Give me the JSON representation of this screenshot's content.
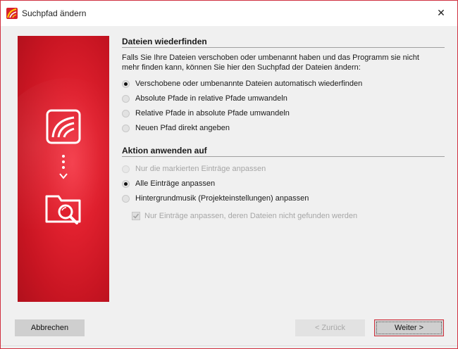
{
  "window": {
    "title": "Suchpfad ändern",
    "close_glyph": "✕",
    "app_icon": "app-logo-icon"
  },
  "colors": {
    "accent": "#d0303c",
    "panel_red": "#e0202e",
    "background": "#f0f0f0"
  },
  "panel": {
    "icons": [
      "curves-document-icon",
      "dotted-arrow-down-icon",
      "folder-search-icon"
    ]
  },
  "section_find": {
    "title": "Dateien wiederfinden",
    "description": "Falls Sie Ihre Dateien verschoben oder umbenannt haben und das Programm sie nicht mehr finden kann, können Sie hier den Suchpfad der Dateien ändern:",
    "options": [
      {
        "label": "Verschobene oder umbenannte Dateien automatisch wiederfinden",
        "checked": true,
        "enabled": true
      },
      {
        "label": "Absolute Pfade in relative Pfade umwandeln",
        "checked": false,
        "enabled": true
      },
      {
        "label": "Relative Pfade in absolute Pfade umwandeln",
        "checked": false,
        "enabled": true
      },
      {
        "label": "Neuen Pfad direkt angeben",
        "checked": false,
        "enabled": true
      }
    ]
  },
  "section_apply": {
    "title": "Aktion anwenden auf",
    "options": [
      {
        "label": "Nur die markierten Einträge anpassen",
        "checked": false,
        "enabled": false
      },
      {
        "label": "Alle Einträge anpassen",
        "checked": true,
        "enabled": true
      },
      {
        "label": "Hintergrundmusik (Projekteinstellungen) anpassen",
        "checked": false,
        "enabled": true
      }
    ],
    "checkbox": {
      "label": "Nur Einträge anpassen, deren Dateien nicht gefunden werden",
      "checked": true,
      "enabled": false
    }
  },
  "buttons": {
    "cancel": "Abbrechen",
    "back": "< Zurück",
    "next": "Weiter >"
  }
}
